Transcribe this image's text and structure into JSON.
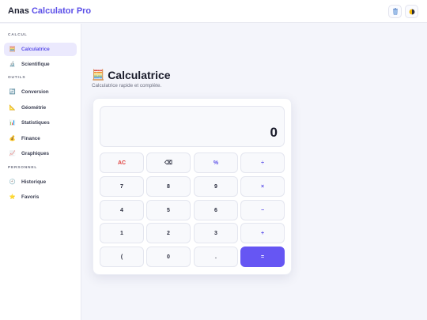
{
  "header": {
    "brand_name": "Anas",
    "brand_accent": "Calculator Pro",
    "buttons": [
      {
        "name": "trash-icon"
      },
      {
        "name": "theme-toggle-icon"
      }
    ]
  },
  "sidebar": {
    "sections": [
      {
        "label": "CALCUL"
      },
      {
        "label": "OUTILS"
      },
      {
        "label": "PERSONNEL"
      }
    ],
    "items": [
      {
        "label": "Calculatrice",
        "icon": "🧮",
        "active": true
      },
      {
        "label": "Scientifique",
        "icon": "🔬"
      },
      {
        "label": "Conversion",
        "icon": "🔄"
      },
      {
        "label": "Géométrie",
        "icon": "📐"
      },
      {
        "label": "Statistiques",
        "icon": "📊"
      },
      {
        "label": "Finance",
        "icon": "💰"
      },
      {
        "label": "Graphiques",
        "icon": "📈"
      },
      {
        "label": "Historique",
        "icon": "🕘"
      },
      {
        "label": "Favoris",
        "icon": "⭐"
      }
    ]
  },
  "main": {
    "title_icon": "🧮",
    "title": "Calculatrice",
    "subtitle": "Calculatrice rapide et complète."
  },
  "calculator": {
    "display": "0",
    "keys": [
      {
        "label": "AC"
      },
      {
        "label": "⌫"
      },
      {
        "label": "%"
      },
      {
        "label": "÷"
      },
      {
        "label": "7"
      },
      {
        "label": "8"
      },
      {
        "label": "9"
      },
      {
        "label": "×"
      },
      {
        "label": "4"
      },
      {
        "label": "5"
      },
      {
        "label": "6"
      },
      {
        "label": "−"
      },
      {
        "label": "1"
      },
      {
        "label": "2"
      },
      {
        "label": "3"
      },
      {
        "label": "+"
      },
      {
        "label": "("
      },
      {
        "label": "0"
      },
      {
        "label": "."
      },
      {
        "label": "="
      }
    ]
  },
  "colors": {
    "accent": "#5b4fe8",
    "equals_bg": "#6656f3",
    "danger": "#e0413e",
    "active_bg": "#ebe9fd"
  }
}
